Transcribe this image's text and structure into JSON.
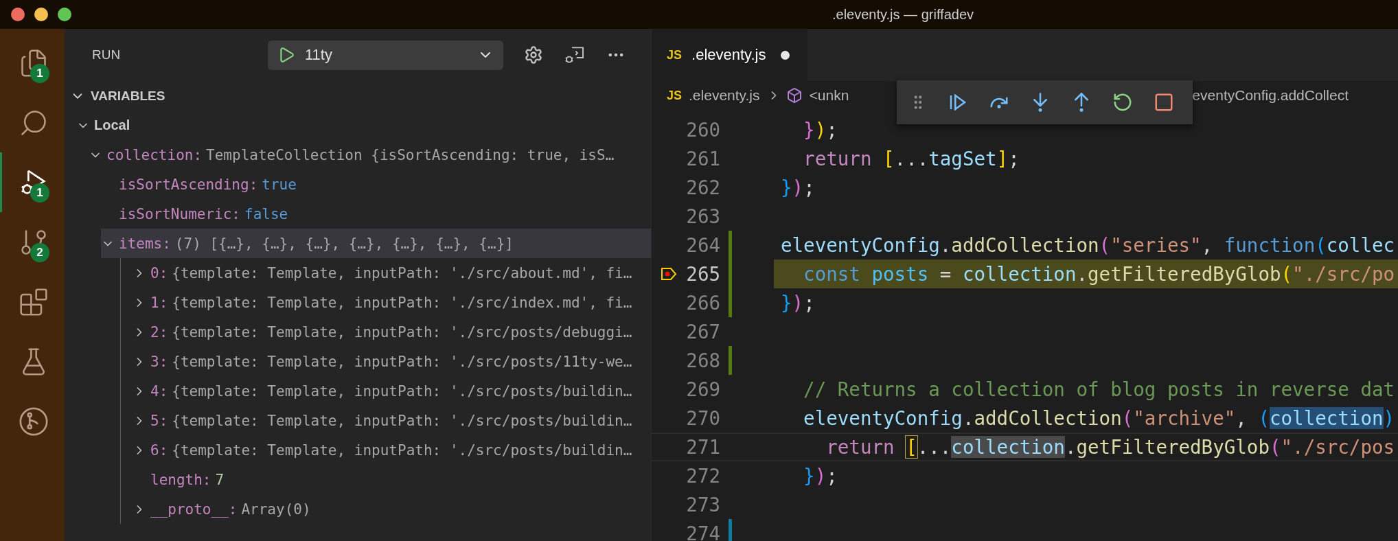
{
  "window": {
    "title": ".eleventy.js — griffadev"
  },
  "activity_bar": [
    {
      "kind": "files",
      "badge": "1",
      "selected": false
    },
    {
      "kind": "search",
      "selected": false
    },
    {
      "kind": "debug",
      "badge": "1",
      "selected": true
    },
    {
      "kind": "source-control",
      "badge": "2",
      "selected": false
    },
    {
      "kind": "extensions",
      "selected": false
    },
    {
      "kind": "testing",
      "selected": false
    },
    {
      "kind": "remote",
      "selected": false
    }
  ],
  "sidebar": {
    "title": "RUN",
    "config": {
      "label": "11ty"
    },
    "sections": [
      {
        "label": "VARIABLES",
        "expanded": true,
        "children": [
          {
            "name": "Local",
            "kind": "scope",
            "expanded": true,
            "selected": false,
            "children": [
              {
                "name": "collection:",
                "value": "TemplateCollection {isSortAscending: true, isS…",
                "kind": "object",
                "expanded": true,
                "selected": false,
                "children": [
                  {
                    "name": "isSortAscending:",
                    "value": "true",
                    "kind": "boolean",
                    "selected": false
                  },
                  {
                    "name": "isSortNumeric:",
                    "value": "false",
                    "kind": "boolean",
                    "selected": false
                  },
                  {
                    "name": "items:",
                    "value": "(7) [{…}, {…}, {…}, {…}, {…}, {…}, {…}]",
                    "kind": "object",
                    "expanded": true,
                    "selected": true,
                    "children": [
                      {
                        "name": "0:",
                        "value": "{template: Template, inputPath: './src/about.md', fi…",
                        "kind": "object",
                        "expanded": false,
                        "selected": false
                      },
                      {
                        "name": "1:",
                        "value": "{template: Template, inputPath: './src/index.md', fi…",
                        "kind": "object",
                        "expanded": false,
                        "selected": false
                      },
                      {
                        "name": "2:",
                        "value": "{template: Template, inputPath: './src/posts/debuggi…",
                        "kind": "object",
                        "expanded": false,
                        "selected": false
                      },
                      {
                        "name": "3:",
                        "value": "{template: Template, inputPath: './src/posts/11ty-we…",
                        "kind": "object",
                        "expanded": false,
                        "selected": false
                      },
                      {
                        "name": "4:",
                        "value": "{template: Template, inputPath: './src/posts/buildin…",
                        "kind": "object",
                        "expanded": false,
                        "selected": false
                      },
                      {
                        "name": "5:",
                        "value": "{template: Template, inputPath: './src/posts/buildin…",
                        "kind": "object",
                        "expanded": false,
                        "selected": false
                      },
                      {
                        "name": "6:",
                        "value": "{template: Template, inputPath: './src/posts/buildin…",
                        "kind": "object",
                        "expanded": false,
                        "selected": false
                      },
                      {
                        "name": "length:",
                        "value": "7",
                        "kind": "number",
                        "selected": false
                      },
                      {
                        "name": "__proto__:",
                        "value": "Array(0)",
                        "kind": "object",
                        "expanded": false,
                        "selected": false
                      }
                    ]
                  }
                ]
              }
            ]
          }
        ]
      }
    ]
  },
  "editor": {
    "tabs": [
      {
        "icon_text": "JS",
        "label": ".eleventy.js",
        "modified": true,
        "selected": true
      }
    ],
    "breadcrumbs": [
      {
        "kind": "file",
        "icon_text": "JS",
        "label": ".eleventy.js"
      },
      {
        "kind": "symbol",
        "label": "<unkn"
      },
      {
        "kind": "plain",
        "label": "eventyConfig.addCollect"
      }
    ],
    "debug_toolbar": [
      {
        "kind": "grip"
      },
      {
        "kind": "continue"
      },
      {
        "kind": "step-over"
      },
      {
        "kind": "step-into"
      },
      {
        "kind": "step-out"
      },
      {
        "kind": "restart"
      },
      {
        "kind": "stop"
      }
    ],
    "lines": [
      {
        "number": "260",
        "tokens": [
          {
            "text": "  }",
            "kind": "b2"
          },
          {
            "text": ")",
            "kind": "b1"
          },
          {
            "text": ";",
            "kind": "plain"
          }
        ]
      },
      {
        "number": "261",
        "tokens": [
          {
            "text": "  return ",
            "kind": "keyword"
          },
          {
            "text": "[",
            "kind": "b1"
          },
          {
            "text": "...",
            "kind": "plain"
          },
          {
            "text": "tagSet",
            "kind": "var"
          },
          {
            "text": "]",
            "kind": "b1"
          },
          {
            "text": ";",
            "kind": "plain"
          }
        ]
      },
      {
        "number": "262",
        "tokens": [
          {
            "text": "}",
            "kind": "b3"
          },
          {
            "text": ")",
            "kind": "b2"
          },
          {
            "text": ";",
            "kind": "plain"
          }
        ]
      },
      {
        "number": "263"
      },
      {
        "number": "264",
        "added": true,
        "tokens": [
          {
            "text": "eleventyConfig",
            "kind": "var"
          },
          {
            "text": ".",
            "kind": "plain"
          },
          {
            "text": "addCollection",
            "kind": "fn"
          },
          {
            "text": "(",
            "kind": "b2"
          },
          {
            "text": "\"series\"",
            "kind": "string"
          },
          {
            "text": ", ",
            "kind": "plain"
          },
          {
            "text": "function",
            "kind": "storage"
          },
          {
            "text": "(",
            "kind": "b3"
          },
          {
            "text": "collec",
            "kind": "var"
          }
        ]
      },
      {
        "number": "265",
        "added": true,
        "paused": true,
        "tokens": [
          {
            "text": "  const ",
            "kind": "storage"
          },
          {
            "text": "posts",
            "kind": "const"
          },
          {
            "text": " = ",
            "kind": "plain"
          },
          {
            "text": "collection",
            "kind": "var"
          },
          {
            "text": ".",
            "kind": "plain"
          },
          {
            "text": "getFilteredByGlob",
            "kind": "fn"
          },
          {
            "text": "(",
            "kind": "b1"
          },
          {
            "text": "\"./src/po",
            "kind": "string"
          }
        ]
      },
      {
        "number": "266",
        "added": true,
        "tokens": [
          {
            "text": "}",
            "kind": "b3"
          },
          {
            "text": ")",
            "kind": "b2"
          },
          {
            "text": ";",
            "kind": "plain"
          }
        ]
      },
      {
        "number": "267"
      },
      {
        "number": "268",
        "added": true
      },
      {
        "number": "269",
        "tokens": [
          {
            "text": "  // Returns a collection of blog posts in reverse dat",
            "kind": "comment"
          }
        ]
      },
      {
        "number": "270",
        "tokens": [
          {
            "text": "  eleventyConfig",
            "kind": "var"
          },
          {
            "text": ".",
            "kind": "plain"
          },
          {
            "text": "addCollection",
            "kind": "fn"
          },
          {
            "text": "(",
            "kind": "b2"
          },
          {
            "text": "\"archive\"",
            "kind": "string"
          },
          {
            "text": ", ",
            "kind": "plain"
          },
          {
            "text": "(",
            "kind": "b3"
          },
          {
            "text": "collection",
            "kind": "var",
            "selection": true
          },
          {
            "text": ")",
            "kind": "b3"
          }
        ]
      },
      {
        "number": "271",
        "cursor": true,
        "tokens": [
          {
            "text": "    return ",
            "kind": "keyword"
          },
          {
            "text": "[",
            "kind": "b1",
            "bracket_match": true
          },
          {
            "text": "...",
            "kind": "plain"
          },
          {
            "text": "collection",
            "kind": "var",
            "word_highlight": true
          },
          {
            "text": ".",
            "kind": "plain"
          },
          {
            "text": "getFilteredByGlob",
            "kind": "fn"
          },
          {
            "text": "(",
            "kind": "b2"
          },
          {
            "text": "\"./src/pos",
            "kind": "string"
          }
        ]
      },
      {
        "number": "272",
        "tokens": [
          {
            "text": "  }",
            "kind": "b3"
          },
          {
            "text": ")",
            "kind": "b2"
          },
          {
            "text": ";",
            "kind": "plain"
          }
        ]
      },
      {
        "number": "273"
      },
      {
        "number": "274",
        "modified": true
      }
    ]
  }
}
